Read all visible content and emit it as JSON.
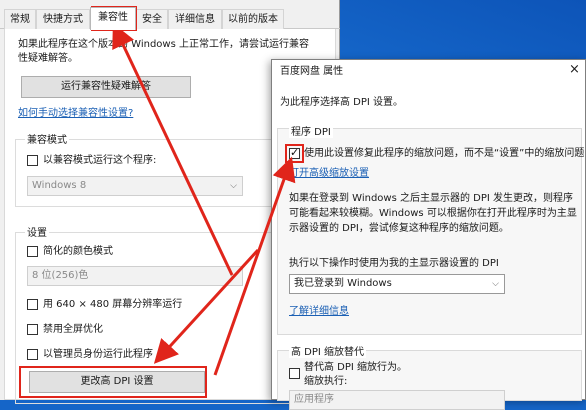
{
  "back_dialog": {
    "tabs": [
      "常规",
      "快捷方式",
      "兼容性",
      "安全",
      "详细信息",
      "以前的版本"
    ],
    "intro": "如果此程序在这个版本的 Windows 上正常工作，请尝试运行兼容性疑难解答。",
    "run_troubleshooter": "运行兼容性疑难解答",
    "manual_link": "如何手动选择兼容性设置?",
    "compat_mode": {
      "title": "兼容模式",
      "checkbox": "以兼容模式运行这个程序:",
      "select_value": "Windows 8"
    },
    "settings": {
      "title": "设置",
      "reduced_color": "简化的颜色模式",
      "color_select": "8 位(256)色",
      "res_640": "用 640 × 480 屏幕分辨率运行",
      "disable_fullscreen": "禁用全屏优化",
      "run_admin": "以管理员身份运行此程序",
      "change_dpi_button": "更改高 DPI 设置"
    }
  },
  "front_dialog": {
    "title": "百度网盘 属性",
    "close_symbol": "×",
    "subtitle": "为此程序选择高 DPI 设置。",
    "program_dpi": {
      "title": "程序 DPI",
      "checkbox": "使用此设置修复此程序的缩放问题，而不是“设置”中的缩放问题",
      "checked": true,
      "open_link": "打开高级缩放设置",
      "description": "如果在登录到 Windows 之后主显示器的 DPI 发生更改，则程序可能看起来较模糊。Windows 可以根据你在打开此程序时为主显示器设置的 DPI，尝试修复这种程序的缩放问题。",
      "select_label": "执行以下操作时使用为我的主显示器设置的 DPI",
      "select_value": "我已登录到 Windows",
      "learn_more": "了解详细信息"
    },
    "override": {
      "title": "高 DPI 缩放替代",
      "checkbox_line1": "替代高 DPI 缩放行为。",
      "checkbox_line2": "缩放执行:",
      "select_value": "应用程序"
    }
  },
  "colors": {
    "annotation_red": "#e0251b",
    "desktop_blue": "#1565c8",
    "link_blue": "#1a5fb4"
  }
}
